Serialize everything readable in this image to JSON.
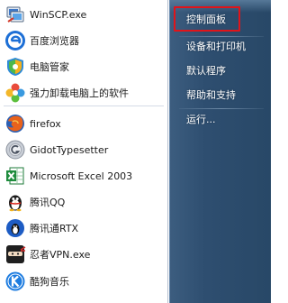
{
  "programs": [
    {
      "label": "WinSCP.exe",
      "icon": "winscp-icon"
    },
    {
      "label": "百度浏览器",
      "icon": "baidu-browser-icon"
    },
    {
      "label": "电脑管家",
      "icon": "pc-manager-shield-icon"
    },
    {
      "label": "强力卸载电脑上的软件",
      "icon": "uninstall-flower-icon"
    },
    {
      "label": "firefox",
      "icon": "firefox-icon"
    },
    {
      "label": "GidotTypesetter",
      "icon": "gidot-typesetter-icon"
    },
    {
      "label": "Microsoft Excel 2003",
      "icon": "excel-icon"
    },
    {
      "label": "腾讯QQ",
      "icon": "qq-penguin-icon"
    },
    {
      "label": "腾讯通RTX",
      "icon": "rtx-icon"
    },
    {
      "label": "忍者VPN.exe",
      "icon": "ninja-vpn-icon"
    },
    {
      "label": "酷狗音乐",
      "icon": "kugou-music-icon"
    }
  ],
  "places": [
    {
      "label": "控制面板",
      "highlighted": true
    },
    {
      "label": "设备和打印机",
      "highlighted": false
    },
    {
      "label": "默认程序",
      "highlighted": false
    },
    {
      "label": "帮助和支持",
      "highlighted": false
    },
    {
      "label": "运行...",
      "highlighted": false
    }
  ],
  "colors": {
    "highlight_border": "#e0141a",
    "right_pane": "#2e4e70"
  }
}
